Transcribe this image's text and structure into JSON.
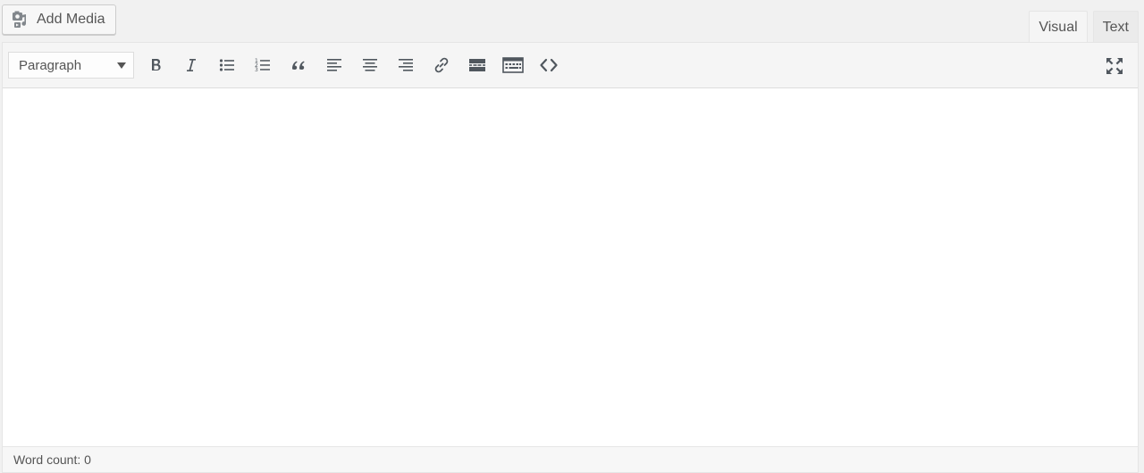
{
  "toolbar_top": {
    "add_media_label": "Add Media",
    "add_media_icon": "media-icon"
  },
  "tabs": [
    {
      "label": "Visual",
      "active": true
    },
    {
      "label": "Text",
      "active": false
    }
  ],
  "editor_toolbar": {
    "format_select": "Paragraph",
    "buttons": [
      "bold-icon",
      "italic-icon",
      "bulleted-list-icon",
      "numbered-list-icon",
      "blockquote-icon",
      "align-left-icon",
      "align-center-icon",
      "align-right-icon",
      "link-icon",
      "read-more-icon",
      "toolbar-toggle-icon",
      "code-icon"
    ],
    "fullscreen_icon": "fullscreen-icon"
  },
  "status": {
    "word_count": "Word count: 0"
  },
  "colors": {
    "icon": "#50575e",
    "background": "#f1f1f1",
    "editor_bg": "#ffffff"
  }
}
